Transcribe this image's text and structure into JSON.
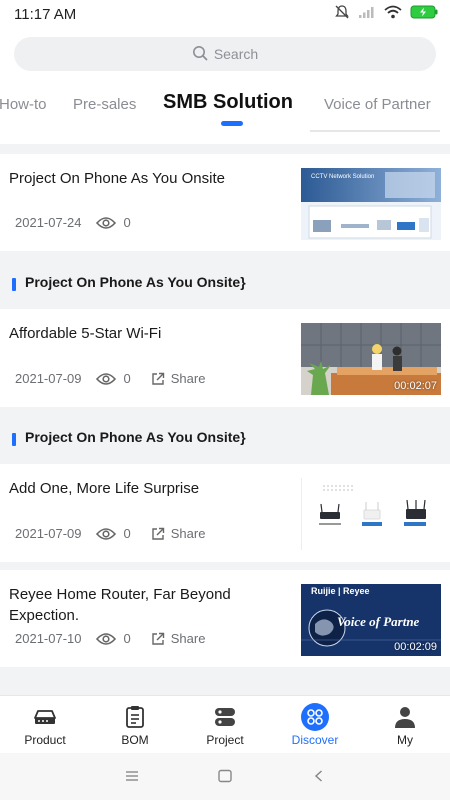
{
  "status": {
    "time": "11:17  AM"
  },
  "search": {
    "placeholder": "Search"
  },
  "tabs": [
    {
      "label": "How-to"
    },
    {
      "label": "Pre-sales"
    },
    {
      "label": "SMB Solution"
    },
    {
      "label": "Voice of Partner"
    }
  ],
  "feed": {
    "items": [
      {
        "title": "Project On Phone As You Onsite",
        "date": "2021-07-24",
        "views": "0",
        "thumb_text": "CCTV Network Solution"
      },
      {
        "title": "Affordable 5-Star Wi-Fi",
        "date": "2021-07-09",
        "views": "0",
        "share": "Share",
        "duration": "00:02:07"
      },
      {
        "title": "Add One, More Life Surprise",
        "date": "2021-07-09",
        "views": "0",
        "share": "Share"
      },
      {
        "title": "Reyee Home Router, Far Beyond Expection.",
        "date": "2021-07-10",
        "views": "0",
        "share": "Share",
        "duration": "00:02:09",
        "thumb_brand": "Ruijie | Reyee",
        "thumb_banner": "Voice of Partne"
      }
    ],
    "sections": [
      {
        "title": "Project On Phone As You Onsite}"
      },
      {
        "title": "Project On Phone As You Onsite}"
      }
    ]
  },
  "bottom_nav": {
    "items": [
      {
        "label": "Product",
        "icon": "router-icon"
      },
      {
        "label": "BOM",
        "icon": "clipboard-icon"
      },
      {
        "label": "Project",
        "icon": "project-icon"
      },
      {
        "label": "Discover",
        "icon": "discover-icon",
        "active": true
      },
      {
        "label": "My",
        "icon": "person-icon"
      }
    ]
  },
  "colors": {
    "accent": "#1f6fff",
    "background": "#f2f3f5",
    "card": "#ffffff",
    "battery": "#2ecc40"
  }
}
